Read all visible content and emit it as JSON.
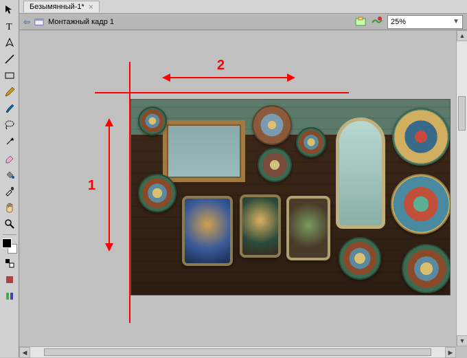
{
  "tabs": {
    "doc1": "Безымянный-1*"
  },
  "document": {
    "title": "Монтажный кадр 1",
    "zoom": "25%"
  },
  "annotations": {
    "label1": "1",
    "label2": "2"
  },
  "icons": {
    "move": "move-icon",
    "text": "text-icon",
    "pen": "pen-icon",
    "line": "line-icon",
    "rect": "rect-icon",
    "pencil": "pencil-icon",
    "brush": "brush-icon",
    "lasso": "lasso-icon",
    "wand": "wand-icon",
    "eraser": "eraser-icon",
    "bucket": "bucket-icon",
    "eyedrop": "eyedrop-icon",
    "hand": "hand-icon",
    "zoom": "zoom-icon"
  }
}
